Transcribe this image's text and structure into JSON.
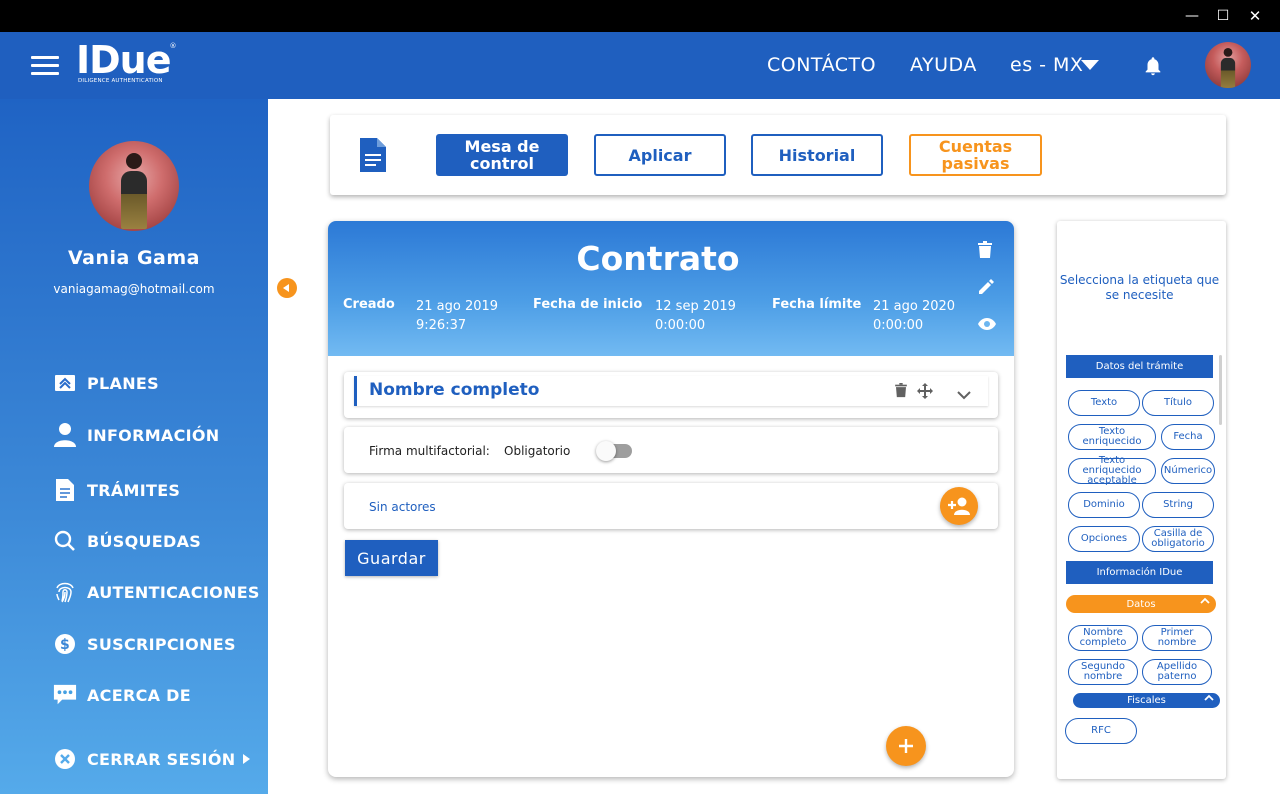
{
  "window": {
    "controls": {
      "minimize": "—",
      "maximize": "☐",
      "close": "✕"
    }
  },
  "header": {
    "logo_text": "IDue",
    "logo_reg": "®",
    "logo_tagline": "DILIGENCE AUTHENTICATION",
    "nav": {
      "contact": "CONTÁCTO",
      "help": "AYUDA",
      "lang": "es - MX"
    }
  },
  "sidebar": {
    "user_name": "Vania Gama",
    "user_email": "vaniagamag@hotmail.com",
    "items": [
      {
        "label": "PLANES",
        "icon": "plans-icon"
      },
      {
        "label": "INFORMACIÓN",
        "icon": "person-icon"
      },
      {
        "label": "TRÁMITES",
        "icon": "document-icon"
      },
      {
        "label": "BÚSQUEDAS",
        "icon": "search-icon"
      },
      {
        "label": "AUTENTICACIONES",
        "icon": "fingerprint-icon"
      },
      {
        "label": "SUSCRIPCIONES",
        "icon": "dollar-icon"
      },
      {
        "label": "ACERCA DE",
        "icon": "chat-icon"
      }
    ],
    "logout": "CERRAR SESIÓN"
  },
  "toolbar": {
    "btn_mesa": "Mesa de control",
    "btn_aplicar": "Aplicar",
    "btn_historial": "Historial",
    "btn_cuentas": "Cuentas pasivas"
  },
  "contract": {
    "title": "Contrato",
    "created_label": "Creado",
    "created_date": "21 ago 2019",
    "created_time": "9:26:37",
    "start_label": "Fecha de inicio",
    "start_date": "12 sep 2019",
    "start_time": "0:00:00",
    "limit_label": "Fecha límite",
    "limit_date": "21 ago 2020",
    "limit_time": "0:00:00",
    "field_name": "Nombre completo",
    "mfa_label": "Firma multifactorial:",
    "mfa_value": "Obligatorio",
    "actors_text": "Sin actores",
    "save_label": "Guardar"
  },
  "tags_panel": {
    "hint": "Selecciona la etiqueta que se necesite",
    "section_tramite": "Datos del trámite",
    "tramite_tags": [
      "Texto",
      "Título",
      "Texto enriquecido",
      "Fecha",
      "Texto enriquecido aceptable",
      "Númerico",
      "Dominio",
      "String",
      "Opciones",
      "Casilla de obligatorio"
    ],
    "section_idue": "Información IDue",
    "datos_label": "Datos",
    "datos_tags": [
      "Nombre completo",
      "Primer nombre",
      "Segundo nombre",
      "Apellido paterno"
    ],
    "fiscales_label": "Fiscales",
    "fiscales_tags": [
      "RFC"
    ]
  },
  "colors": {
    "primary": "#1f5fbf",
    "accent": "#f7941d"
  }
}
